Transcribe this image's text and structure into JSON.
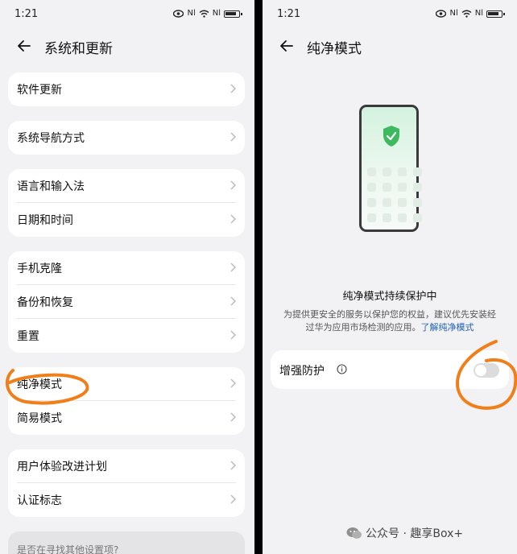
{
  "left": {
    "status": {
      "time": "1:21",
      "sig1": "Nl",
      "sig2": "Nl"
    },
    "title": "系统和更新",
    "groups": [
      {
        "items": [
          "软件更新"
        ]
      },
      {
        "items": [
          "系统导航方式"
        ]
      },
      {
        "items": [
          "语言和输入法",
          "日期和时间"
        ]
      },
      {
        "items": [
          "手机克隆",
          "备份和恢复",
          "重置"
        ]
      },
      {
        "items": [
          "纯净模式",
          "简易模式"
        ]
      },
      {
        "items": [
          "用户体验改进计划",
          "认证标志"
        ]
      }
    ],
    "bottom_hint": "是否在寻找其他设置项?"
  },
  "right": {
    "status": {
      "time": "1:21",
      "sig1": "Nl",
      "sig2": "Nl"
    },
    "title": "纯净模式",
    "protect_title": "纯净模式持续保护中",
    "protect_desc": "为提供更安全的服务以保护您的权益，建议优先安装经过华为应用市场检测的应用。",
    "learn_more": "了解纯净模式",
    "enhanced_label": "增强防护",
    "enhanced_enabled": false,
    "watermark": "公众号 · 趣享Box+"
  },
  "colors": {
    "accent_link": "#1d5fbf",
    "shield": "#3dba5f",
    "annotation": "#f07f1a"
  }
}
